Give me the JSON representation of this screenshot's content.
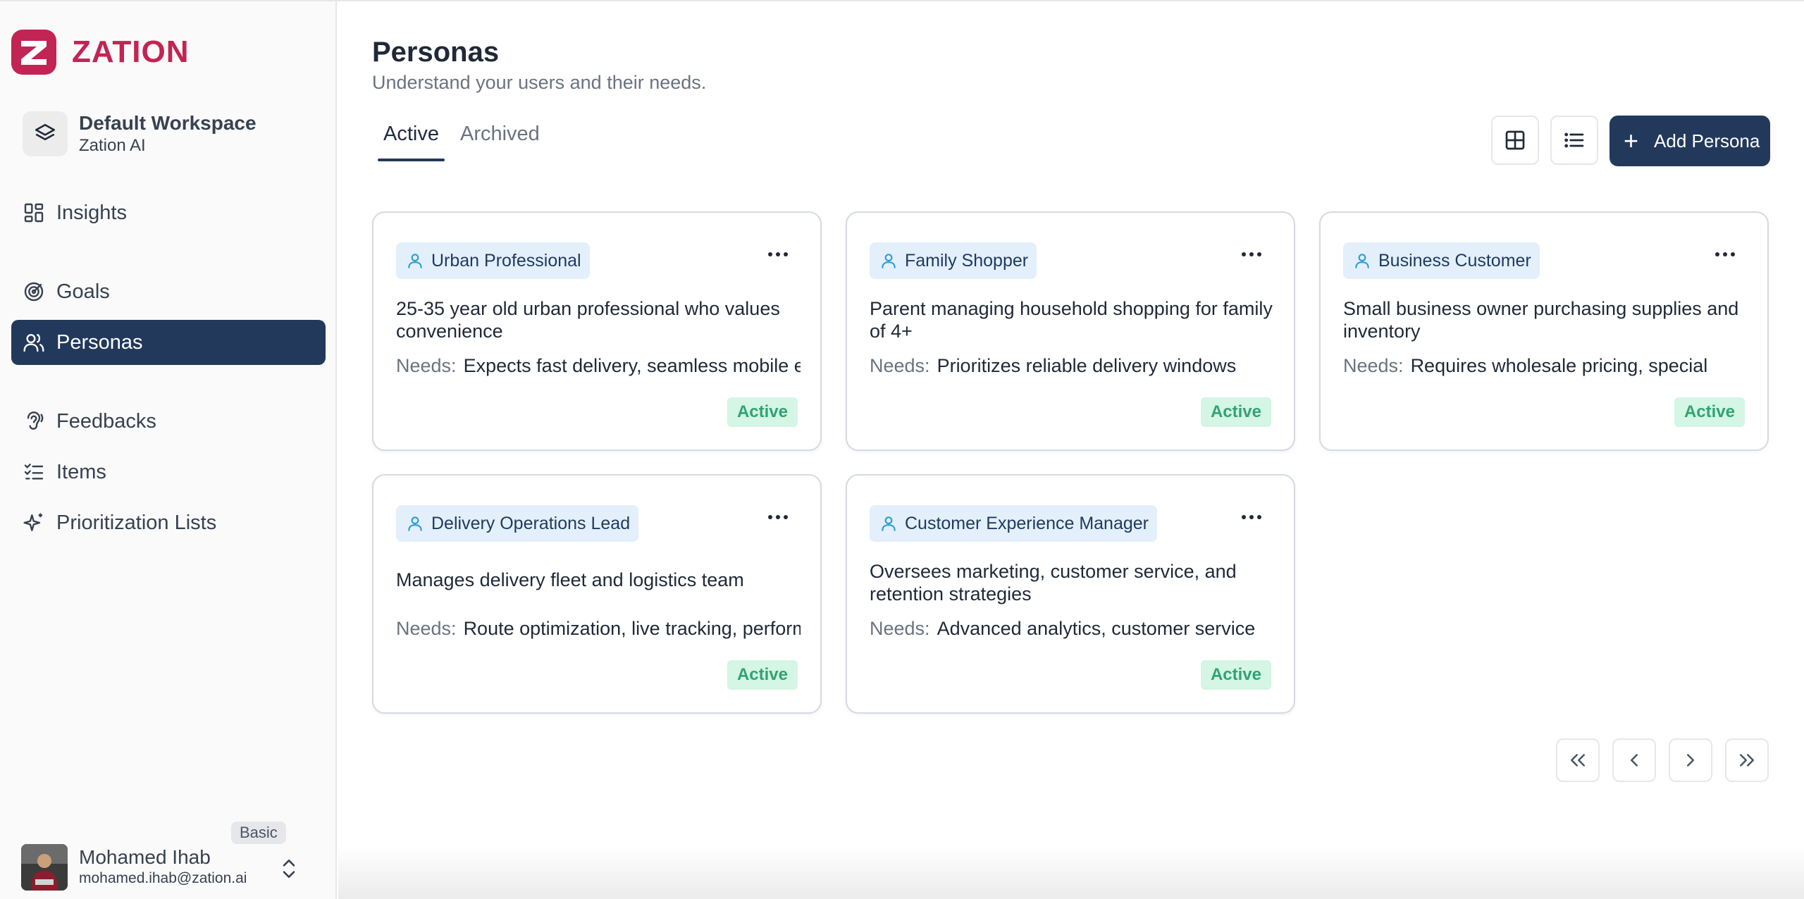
{
  "brand": {
    "name": "ZATION",
    "color": "#c22454"
  },
  "workspace": {
    "name": "Default Workspace",
    "org": "Zation AI"
  },
  "nav": {
    "insights": "Insights",
    "goals": "Goals",
    "personas": "Personas",
    "feedbacks": "Feedbacks",
    "items": "Items",
    "prioritization": "Prioritization Lists"
  },
  "user": {
    "name": "Mohamed Ihab",
    "email": "mohamed.ihab@zation.ai",
    "plan": "Basic"
  },
  "page": {
    "title": "Personas",
    "subtitle": "Understand your users and their needs."
  },
  "tabs": {
    "active": "Active",
    "archived": "Archived"
  },
  "actions": {
    "add_persona": "Add Persona"
  },
  "needs_label": "Needs:",
  "personas": [
    {
      "name": "Urban Professional",
      "description": "25-35 year old urban professional who values convenience",
      "needs": "Expects fast delivery, seamless mobile experience",
      "status": "Active"
    },
    {
      "name": "Family Shopper",
      "description": "Parent managing household shopping for family of 4+",
      "needs": "Prioritizes reliable delivery windows",
      "status": "Active"
    },
    {
      "name": "Business Customer",
      "description": "Small business owner purchasing supplies and inventory",
      "needs": "Requires wholesale pricing, special",
      "status": "Active"
    },
    {
      "name": "Delivery Operations Lead",
      "description": "Manages delivery fleet and logistics team",
      "needs": "Route optimization, live tracking, performance",
      "status": "Active"
    },
    {
      "name": "Customer Experience Manager",
      "description": "Oversees marketing, customer service, and retention strategies",
      "needs": "Advanced analytics, customer service",
      "status": "Active"
    }
  ],
  "colors": {
    "primary": "#23395b",
    "status_bg": "#d5f5e5",
    "status_text": "#2fa56f",
    "tag_bg": "#e3effa",
    "icon_accent": "#2a9fd6"
  }
}
